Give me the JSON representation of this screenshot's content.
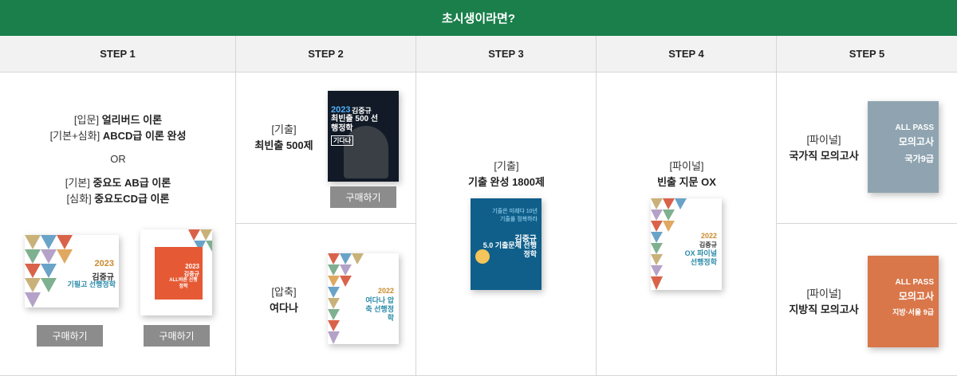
{
  "banner": {
    "title": "초시생이라면?"
  },
  "steps": [
    {
      "label": "STEP 1"
    },
    {
      "label": "STEP 2"
    },
    {
      "label": "STEP 3"
    },
    {
      "label": "STEP 4"
    },
    {
      "label": "STEP 5"
    }
  ],
  "step1": {
    "lines": [
      {
        "prefix": "[입문] ",
        "strong": "얼리버드 이론"
      },
      {
        "prefix": "[기본+심화] ",
        "strong": "ABCD급 이론 완성"
      },
      {
        "prefix": "",
        "strong": "",
        "plain": "OR"
      },
      {
        "prefix": "[기본] ",
        "strong": "중요도 AB급 이론"
      },
      {
        "prefix": "[심화] ",
        "strong": "중요도CD급 이론"
      }
    ],
    "book1": {
      "year": "2023",
      "author": "김중규",
      "title": "기필고 선행정학"
    },
    "book2": {
      "year": "2023",
      "author": "김중규",
      "title": "ALL바른 선행정학"
    },
    "buy_label_1": "구매하기",
    "buy_label_2": "구매하기"
  },
  "step2": {
    "top": {
      "prefix": "[기출]",
      "title": "최빈출 500제",
      "buy_label": "구매하기",
      "book": {
        "year": "2023",
        "author": "김중규",
        "title": "최빈출 500 선행정학",
        "tag": "기다나"
      }
    },
    "bottom": {
      "prefix": "[압축]",
      "title": "여다나",
      "book": {
        "year": "2022",
        "author": "김중규",
        "title": "여다나 압축 선행정학"
      }
    }
  },
  "step3": {
    "prefix": "[기출]",
    "title": "기출 완성 1800제",
    "book": {
      "head": "기출은 미래다 10년기출을 정복하라",
      "author": "김중규",
      "title": "5.0 기출문제 선행정학"
    }
  },
  "step4": {
    "prefix": "[파이널]",
    "title": "빈출 지문 OX",
    "book": {
      "year": "2022",
      "author": "김중규",
      "title": "OX 파이널 선행정학"
    }
  },
  "step5": {
    "top": {
      "prefix": "[파이널]",
      "title": "국가직 모의고사",
      "book": {
        "brand": "ALL PASS",
        "title": "모의고사",
        "sub": "국가9급"
      }
    },
    "bottom": {
      "prefix": "[파이널]",
      "title": "지방직 모의고사",
      "book": {
        "brand": "ALL PASS",
        "title": "모의고사",
        "sub": "지방·서울 9급"
      }
    }
  },
  "colors": {
    "banner": "#1a7f4b",
    "button": "#8c8c8c",
    "header_bg": "#f2f2f2",
    "border": "#d6d6d6"
  }
}
